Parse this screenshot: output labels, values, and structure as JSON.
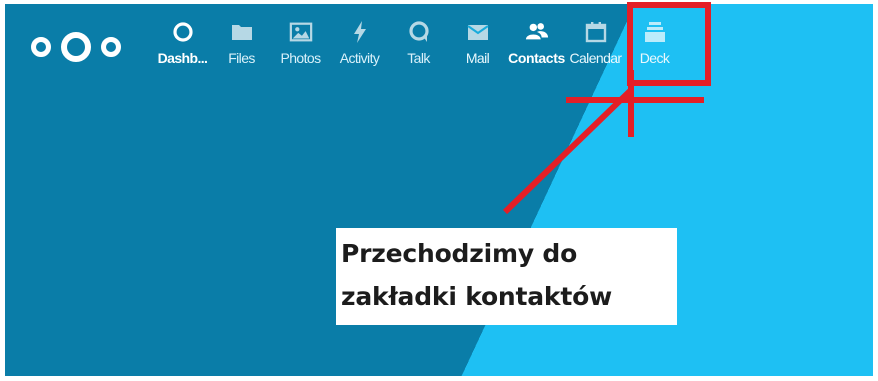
{
  "app": {
    "logo": "nextcloud-logo"
  },
  "nav": {
    "items": [
      {
        "label": "Dashb...",
        "icon": "dashboard-icon"
      },
      {
        "label": "Files",
        "icon": "folder-icon"
      },
      {
        "label": "Photos",
        "icon": "image-icon"
      },
      {
        "label": "Activity",
        "icon": "lightning-icon"
      },
      {
        "label": "Talk",
        "icon": "chat-icon"
      },
      {
        "label": "Mail",
        "icon": "mail-icon"
      },
      {
        "label": "Contacts",
        "icon": "contacts-icon"
      },
      {
        "label": "Calendar",
        "icon": "calendar-icon"
      },
      {
        "label": "Deck",
        "icon": "deck-icon"
      }
    ],
    "active": "Contacts"
  },
  "annotation": {
    "line1": "Przechodzimy do",
    "line2": "zakładki kontaktów",
    "color": "#e41f26"
  },
  "colors": {
    "bg_dark": "#0a7da8",
    "bg_light": "#1ec0f3"
  }
}
